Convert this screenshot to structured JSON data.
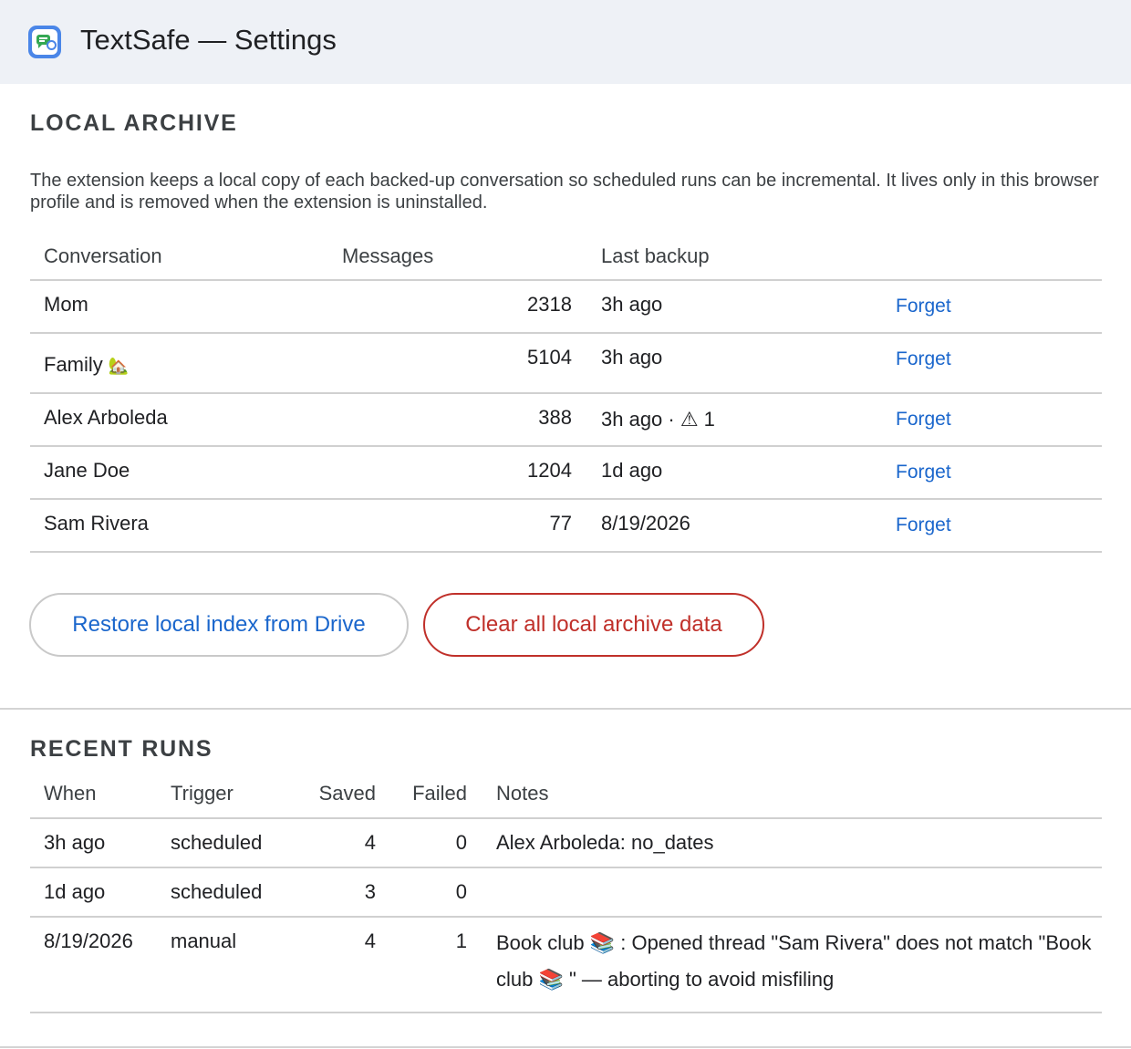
{
  "header": {
    "title": "TextSafe — Settings",
    "logo_icon": "textsafe-logo-icon",
    "background": "#eef1f6"
  },
  "local_archive": {
    "title": "LOCAL ARCHIVE",
    "description": "The extension keeps a local copy of each backed-up conversation so scheduled runs can be incremental. It lives only in this browser profile and is removed when the extension is uninstalled.",
    "columns": [
      "Conversation",
      "Messages",
      "Last backup",
      ""
    ],
    "rows": [
      {
        "conversation": "Mom",
        "emoji": "",
        "messages": "2318",
        "last_backup": "3h ago",
        "warning": "",
        "action": "Forget"
      },
      {
        "conversation": "Family",
        "emoji": "🏡",
        "messages": "5104",
        "last_backup": "3h ago",
        "warning": "",
        "action": "Forget"
      },
      {
        "conversation": "Alex Arboleda",
        "emoji": "",
        "messages": "388",
        "last_backup": "3h ago · ",
        "warning": "⚠ 1",
        "action": "Forget"
      },
      {
        "conversation": "Jane Doe",
        "emoji": "",
        "messages": "1204",
        "last_backup": "1d ago",
        "warning": "",
        "action": "Forget"
      },
      {
        "conversation": "Sam Rivera",
        "emoji": "",
        "messages": "77",
        "last_backup": "8/19/2026",
        "warning": "",
        "action": "Forget"
      }
    ],
    "buttons": {
      "restore": "Restore local index from Drive",
      "clear": "Clear all local archive data"
    }
  },
  "recent_runs": {
    "title": "RECENT RUNS",
    "columns": [
      "When",
      "Trigger",
      "Saved",
      "Failed",
      "Notes"
    ],
    "rows": [
      {
        "when": "3h ago",
        "trigger": "scheduled",
        "saved": "4",
        "failed": "0",
        "notes": "Alex Arboleda: no_dates"
      },
      {
        "when": "1d ago",
        "trigger": "scheduled",
        "saved": "3",
        "failed": "0",
        "notes": ""
      },
      {
        "when": "8/19/2026",
        "trigger": "manual",
        "saved": "4",
        "failed": "1",
        "notes": "Book club 📚 : Opened thread \"Sam Rivera\" does not match \"Book club 📚 \" — aborting to avoid misfiling"
      }
    ]
  },
  "colors": {
    "link": "#1a66cc",
    "danger": "#c0302a"
  }
}
